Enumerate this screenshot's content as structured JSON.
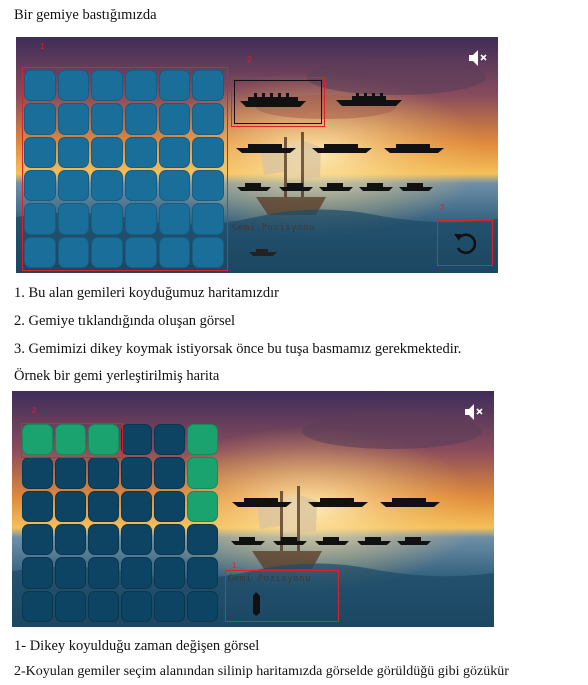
{
  "heading_top": "Bir gemiye bastığımızda",
  "shot1": {
    "markers": [
      "1",
      "2",
      "3"
    ],
    "overlay_text": "Gemi Pozisyonu",
    "grid": {
      "rows": 6,
      "cols": 6,
      "state": "empty"
    }
  },
  "notes_1": [
    "1. Bu alan gemileri koyduğumuz haritamızdır",
    "2. Gemiye tıklandığında oluşan görsel",
    "3. Gemimizi dikey koymak istiyorsak önce bu tuşa basmamız gerekmektedir."
  ],
  "heading_mid": "Örnek bir gemi yerleştirilmiş harita",
  "shot2": {
    "markers": [
      "2",
      "1"
    ],
    "overlay_text": "Gemi Pozisyonu",
    "grid": {
      "rows": 6,
      "cols": 6,
      "placed_cells": [
        [
          0,
          0
        ],
        [
          0,
          1
        ],
        [
          0,
          2
        ],
        [
          0,
          5
        ],
        [
          1,
          5
        ],
        [
          2,
          5
        ]
      ]
    }
  },
  "notes_2": [
    "1- Dikey koyulduğu zaman değişen görsel",
    "2-Koyulan gemiler seçim alanından silinip haritamızda görselde görüldüğü gibi gözükür"
  ],
  "colors": {
    "cell_blue": "#1a6f9a",
    "cell_navy": "#0d4463",
    "cell_green": "#1aa36f",
    "annotation_red": "#d8232a"
  },
  "icons": [
    "speaker-muted-icon",
    "rotate-icon",
    "ship-icon"
  ]
}
